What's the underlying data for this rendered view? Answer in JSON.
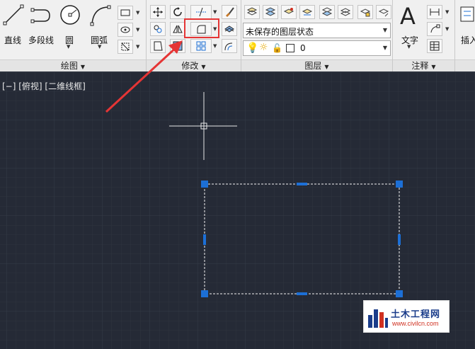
{
  "panels": {
    "draw": {
      "title": "绘图",
      "line": "直线",
      "polyline": "多段线",
      "circle": "圆",
      "arc": "圆弧"
    },
    "modify": {
      "title": "修改"
    },
    "layers": {
      "title": "图层",
      "layer_state": "未保存的图层状态",
      "current_layer": "0"
    },
    "annotation": {
      "title": "注释",
      "text": "文字"
    },
    "insert": {
      "label": "插入"
    }
  },
  "viewport": {
    "label": "[−] [俯视] [二维线框]"
  },
  "watermark": {
    "name": "土木工程网",
    "url": "www.civilcn.com"
  },
  "colors": {
    "canvas_bg": "#252a36",
    "grip": "#1c6fd6",
    "highlight": "#e53535",
    "grid": "#30363f"
  }
}
